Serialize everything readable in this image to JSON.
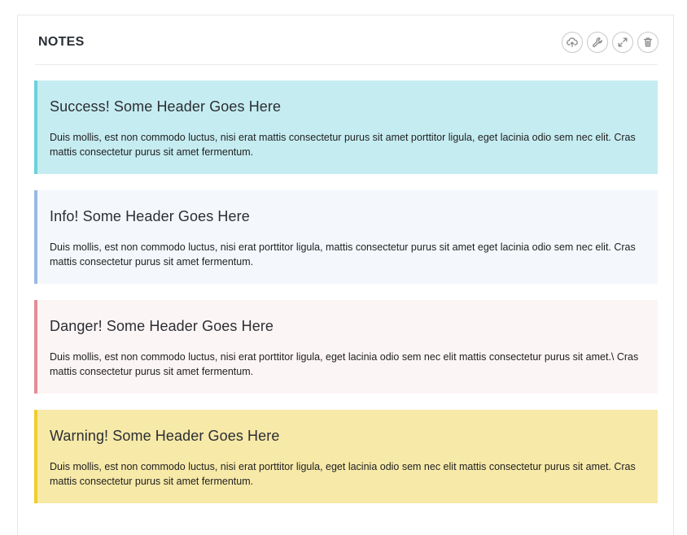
{
  "panel": {
    "title": "NOTES",
    "tools": [
      {
        "name": "cloud-upload-icon"
      },
      {
        "name": "wrench-icon"
      },
      {
        "name": "expand-icon"
      },
      {
        "name": "trash-icon"
      }
    ]
  },
  "notes": [
    {
      "type": "success",
      "header": "Success! Some Header Goes Here",
      "body": "Duis mollis, est non commodo luctus, nisi erat mattis consectetur purus sit amet porttitor ligula, eget lacinia odio sem nec elit. Cras mattis consectetur purus sit amet fermentum.",
      "bg_color": "#c5ecf1",
      "border_color": "#6bd1dc"
    },
    {
      "type": "info",
      "header": "Info! Some Header Goes Here",
      "body": "Duis mollis, est non commodo luctus, nisi erat porttitor ligula, mattis consectetur purus sit amet eget lacinia odio sem nec elit. Cras mattis consectetur purus sit amet fermentum.",
      "bg_color": "#f4f8fc",
      "border_color": "#9bb8e6"
    },
    {
      "type": "danger",
      "header": "Danger! Some Header Goes Here",
      "body": "Duis mollis, est non commodo luctus, nisi erat porttitor ligula, eget lacinia odio sem nec elit mattis consectetur purus sit amet.\\ Cras mattis consectetur purus sit amet fermentum.",
      "bg_color": "#fcf5f5",
      "border_color": "#e38d95"
    },
    {
      "type": "warning",
      "header": "Warning! Some Header Goes Here",
      "body": "Duis mollis, est non commodo luctus, nisi erat porttitor ligula, eget lacinia odio sem nec elit mattis consectetur purus sit amet. Cras mattis consectetur purus sit amet fermentum.",
      "bg_color": "#f7e9a8",
      "border_color": "#f1cd2b"
    }
  ]
}
